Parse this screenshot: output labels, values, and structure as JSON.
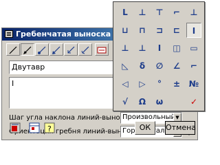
{
  "window": {
    "title": "Гребенчатая выноска"
  },
  "toolbar": {
    "icons": [
      "line-tool-icon",
      "arrow-dot-icon",
      "dot-line-icon",
      "arrow-down-left-icon",
      "arrow-diagonal-icon",
      "arrow-left-icon",
      "box-icon"
    ]
  },
  "fields": {
    "text_line_1": "Двутавр",
    "text_line_2": "I"
  },
  "settings": {
    "angle_step_label": "Шаг угла наклона линий-выносок",
    "angle_step_value": "Произвольный",
    "orientation_label": "Ориентация гребня линий-выносок",
    "orientation_value": "Горизонтально"
  },
  "buttons": {
    "ok": "ОК",
    "cancel": "Отмена"
  },
  "palette": {
    "rows": [
      [
        "L",
        "⊥",
        "⊤",
        "⌐",
        "⊥"
      ],
      [
        "⊔",
        "⊓",
        "⊐",
        "⊏",
        "I"
      ],
      [
        "⊥",
        "⊥",
        "I",
        "◫",
        "▭"
      ],
      [
        "◺",
        "δ",
        "∅",
        "∠",
        "⌐"
      ],
      [
        "◁",
        "▷",
        "°",
        "±",
        "№"
      ],
      [
        "√",
        "Ω",
        "ω",
        "",
        "✓"
      ]
    ],
    "selected": "I"
  }
}
